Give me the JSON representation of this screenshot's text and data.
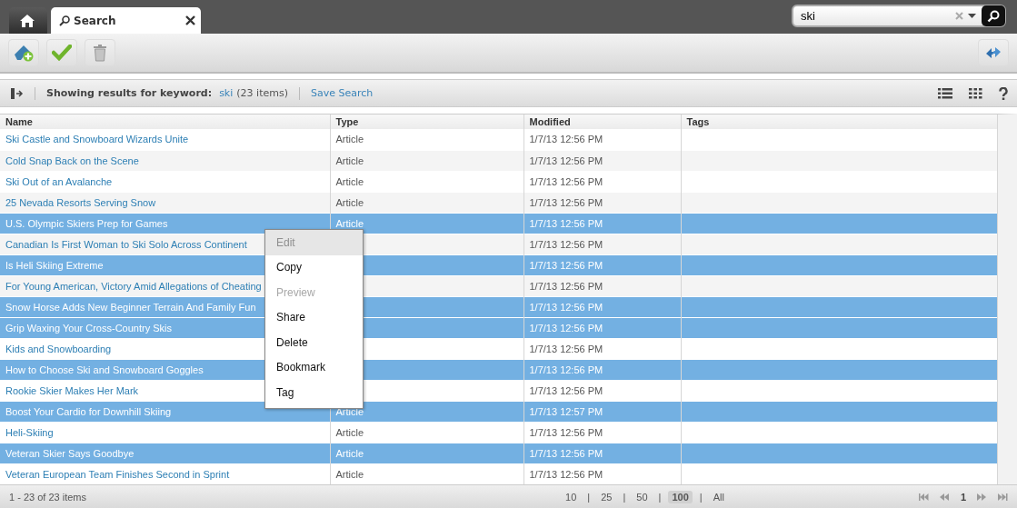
{
  "tabs": [
    {
      "kind": "home",
      "selected": false
    },
    {
      "kind": "search",
      "label": "Search",
      "selected": true
    }
  ],
  "search_field": {
    "value": "ski"
  },
  "results_bar": {
    "label": "Showing results for keyword:",
    "keyword": "ski",
    "count": "(23 items)",
    "save_link": "Save Search"
  },
  "table": {
    "columns": [
      "Name",
      "Type",
      "Modified",
      "Tags"
    ],
    "rows": [
      {
        "name": "Ski Castle and Snowboard Wizards Unite",
        "type": "Article",
        "modified": "1/7/13 12:56 PM",
        "selected": false
      },
      {
        "name": "Cold Snap Back on the Scene",
        "type": "Article",
        "modified": "1/7/13 12:56 PM",
        "selected": false
      },
      {
        "name": "Ski Out of an Avalanche",
        "type": "Article",
        "modified": "1/7/13 12:56 PM",
        "selected": false
      },
      {
        "name": "25 Nevada Resorts Serving Snow",
        "type": "Article",
        "modified": "1/7/13 12:56 PM",
        "selected": false
      },
      {
        "name": "U.S. Olympic Skiers Prep for Games",
        "type": "Article",
        "modified": "1/7/13 12:56 PM",
        "selected": true
      },
      {
        "name": "Canadian Is First Woman to Ski Solo Across Continent",
        "modified": "1/7/13 12:56 PM",
        "selected": false
      },
      {
        "name": "Is Heli Skiing Extreme",
        "modified": "1/7/13 12:56 PM",
        "selected": true
      },
      {
        "name": "For Young American, Victory Amid Allegations of Cheating",
        "modified": "1/7/13 12:56 PM",
        "selected": false
      },
      {
        "name": "Snow Horse Adds New Beginner Terrain And Family Fun",
        "modified": "1/7/13 12:56 PM",
        "selected": true
      },
      {
        "name": "Grip Waxing Your Cross-Country Skis",
        "modified": "1/7/13 12:56 PM",
        "selected": true
      },
      {
        "name": "Kids and Snowboarding",
        "modified": "1/7/13 12:56 PM",
        "selected": false
      },
      {
        "name": "How to Choose Ski and Snowboard Goggles",
        "modified": "1/7/13 12:56 PM",
        "selected": true
      },
      {
        "name": "Rookie Skier Makes Her Mark",
        "modified": "1/7/13 12:56 PM",
        "selected": false
      },
      {
        "name": "Boost Your Cardio for Downhill Skiing",
        "type": "Article",
        "modified": "1/7/13 12:57 PM",
        "selected": true
      },
      {
        "name": "Heli-Skiing",
        "type": "Article",
        "modified": "1/7/13 12:56 PM",
        "selected": false
      },
      {
        "name": "Veteran Skier Says Goodbye",
        "type": "Article",
        "modified": "1/7/13 12:56 PM",
        "selected": true
      },
      {
        "name": "Veteran European Team Finishes Second in Sprint",
        "type": "Article",
        "modified": "1/7/13 12:56 PM",
        "selected": false
      }
    ]
  },
  "context_menu": [
    {
      "label": "Edit",
      "disabled": true,
      "hovered": true
    },
    {
      "label": "Copy",
      "disabled": false,
      "hovered": false
    },
    {
      "label": "Preview",
      "disabled": true,
      "hovered": false
    },
    {
      "label": "Share",
      "disabled": false,
      "hovered": false
    },
    {
      "label": "Delete",
      "disabled": false,
      "hovered": false
    },
    {
      "label": "Bookmark",
      "disabled": false,
      "hovered": false
    },
    {
      "label": "Tag",
      "disabled": false,
      "hovered": false
    }
  ],
  "footer": {
    "summary": "1 - 23 of 23 items",
    "page_sizes": [
      {
        "label": "10",
        "selected": false
      },
      {
        "label": "25",
        "selected": false
      },
      {
        "label": "50",
        "selected": false
      },
      {
        "label": "100",
        "selected": true
      },
      {
        "label": "All",
        "selected": false
      }
    ],
    "separator": "|",
    "page": "1"
  }
}
